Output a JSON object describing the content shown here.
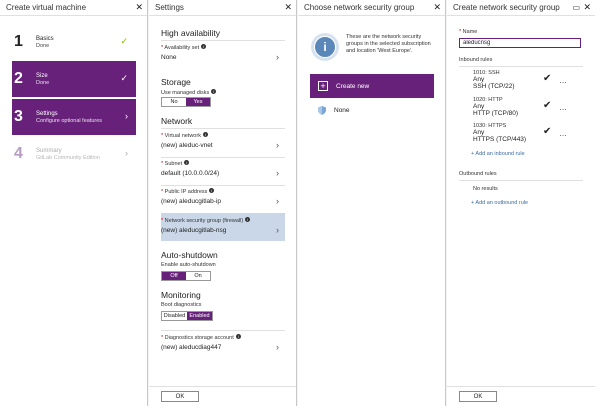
{
  "blade1": {
    "title": "Create virtual machine",
    "steps": [
      {
        "num": "1",
        "title": "Basics",
        "sub": "Done",
        "mark": "✓"
      },
      {
        "num": "2",
        "title": "Size",
        "sub": "Done",
        "mark": "✓"
      },
      {
        "num": "3",
        "title": "Settings",
        "sub": "Configure optional features",
        "mark": "›"
      },
      {
        "num": "4",
        "title": "Summary",
        "sub": "GitLab Community Edition",
        "mark": "›"
      }
    ]
  },
  "blade2": {
    "title": "Settings",
    "high_availability": "High availability",
    "availability_set_label": "Availability set",
    "availability_set_value": "None",
    "storage": "Storage",
    "managed_disks_label": "Use managed disks",
    "managed_no": "No",
    "managed_yes": "Yes",
    "network": "Network",
    "vnet_label": "Virtual network",
    "vnet_value": "(new) aleduc-vnet",
    "subnet_label": "Subnet",
    "subnet_value": "default (10.0.0.0/24)",
    "pip_label": "Public IP address",
    "pip_value": "(new) aleducgitlab-ip",
    "nsg_label": "Network security group (firewall)",
    "nsg_value": "(new) aleducgitlab-nsg",
    "auto_shutdown": "Auto-shutdown",
    "auto_shutdown_label": "Enable auto-shutdown",
    "shutdown_off": "Off",
    "shutdown_on": "On",
    "monitoring": "Monitoring",
    "boot_diag_label": "Boot diagnostics",
    "boot_disabled": "Disabled",
    "boot_enabled": "Enabled",
    "diag_storage_label": "Diagnostics storage account",
    "diag_storage_value": "(new) aleducdiag447",
    "ok": "OK"
  },
  "blade3": {
    "title": "Choose network security group",
    "info_text": "These are the network security groups in the selected subscription and location 'West Europe'.",
    "create_new": "Create new",
    "none": "None"
  },
  "blade4": {
    "title": "Create network security group",
    "name_label": "Name",
    "name_value": "aleducnsg",
    "inbound_label": "Inbound rules",
    "rules": [
      {
        "id": "1010: SSH",
        "any": "Any",
        "proto": "SSH (TCP/22)"
      },
      {
        "id": "1020: HTTP",
        "any": "Any",
        "proto": "HTTP (TCP/80)"
      },
      {
        "id": "1030: HTTPS",
        "any": "Any",
        "proto": "HTTPS (TCP/443)"
      }
    ],
    "add_inbound": "+ Add an inbound rule",
    "outbound_label": "Outbound rules",
    "no_results": "No results",
    "add_outbound": "+ Add an outbound rule",
    "ok": "OK"
  },
  "colors": {
    "accent": "#68217a",
    "highlight": "#c9d7e8",
    "link": "#3a6ea5"
  }
}
